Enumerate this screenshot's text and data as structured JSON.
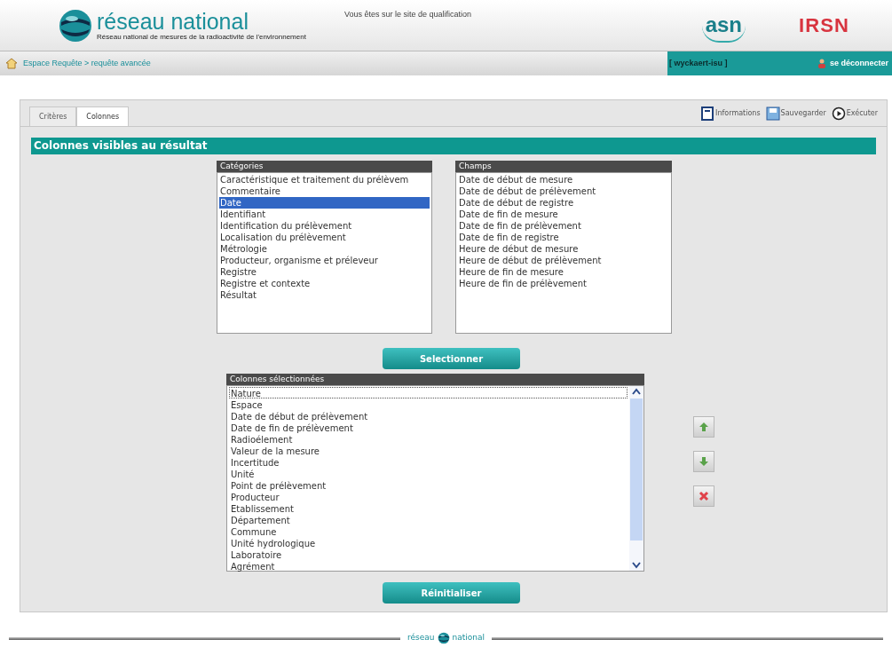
{
  "header": {
    "logo_title": "réseau national",
    "logo_subtitle": "Réseau national de mesures de la radioactivité de l'environnement",
    "notice": "Vous êtes sur le site de qualification",
    "partner_logos": [
      "asn",
      "IRSN"
    ]
  },
  "breadcrumb": {
    "text": "Espace Requête > requête avancée"
  },
  "user": {
    "name": "[ wyckaert-isu ]",
    "logout": "se déconnecter"
  },
  "tabs": [
    {
      "label": "Critères",
      "selected": false
    },
    {
      "label": "Colonnes",
      "selected": true
    }
  ],
  "toolbar": [
    {
      "kind": "info",
      "label": "Informations"
    },
    {
      "kind": "save",
      "label": "Sauvegarder"
    },
    {
      "kind": "run",
      "label": "Exécuter"
    }
  ],
  "section_title": "Colonnes visibles au résultat",
  "categories": {
    "header": "Catégories",
    "items": [
      {
        "label": "Caractéristique et traitement du prélèvem",
        "selected": false
      },
      {
        "label": "Commentaire",
        "selected": false
      },
      {
        "label": "Date",
        "selected": true
      },
      {
        "label": "Identifiant",
        "selected": false
      },
      {
        "label": "Identification du prélèvement",
        "selected": false
      },
      {
        "label": "Localisation du prélèvement",
        "selected": false
      },
      {
        "label": "Métrologie",
        "selected": false
      },
      {
        "label": "Producteur, organisme et préleveur",
        "selected": false
      },
      {
        "label": "Registre",
        "selected": false
      },
      {
        "label": "Registre et contexte",
        "selected": false
      },
      {
        "label": "Résultat",
        "selected": false
      }
    ]
  },
  "fields": {
    "header": "Champs",
    "items": [
      {
        "label": "Date de début de mesure",
        "selected": false
      },
      {
        "label": "Date de début de prélèvement",
        "selected": false
      },
      {
        "label": "Date de début de registre",
        "selected": false
      },
      {
        "label": "Date de fin de mesure",
        "selected": false
      },
      {
        "label": "Date de fin de prélèvement",
        "selected": false
      },
      {
        "label": "Date de fin de registre",
        "selected": false
      },
      {
        "label": "Heure de début de mesure",
        "selected": false
      },
      {
        "label": "Heure de début de prélèvement",
        "selected": false
      },
      {
        "label": "Heure de fin de mesure",
        "selected": false
      },
      {
        "label": "Heure de fin de prélèvement",
        "selected": false
      }
    ]
  },
  "select_button": "Selectionner",
  "selected_columns": {
    "header": "Colonnes sélectionnées",
    "items": [
      {
        "label": "Nature",
        "focused": true
      },
      {
        "label": "Espace",
        "focused": false
      },
      {
        "label": "Date de début de prélèvement",
        "focused": false
      },
      {
        "label": "Date de fin de prélèvement",
        "focused": false
      },
      {
        "label": "Radioélement",
        "focused": false
      },
      {
        "label": "Valeur de la mesure",
        "focused": false
      },
      {
        "label": "Incertitude",
        "focused": false
      },
      {
        "label": "Unité",
        "focused": false
      },
      {
        "label": "Point de prélèvement",
        "focused": false
      },
      {
        "label": "Producteur",
        "focused": false
      },
      {
        "label": "Etablissement",
        "focused": false
      },
      {
        "label": "Département",
        "focused": false
      },
      {
        "label": "Commune",
        "focused": false
      },
      {
        "label": "Unité hydrologique",
        "focused": false
      },
      {
        "label": "Laboratoire",
        "focused": false
      },
      {
        "label": "Agrément",
        "focused": false
      }
    ]
  },
  "order_buttons": [
    {
      "kind": "up"
    },
    {
      "kind": "down"
    },
    {
      "kind": "remove"
    }
  ],
  "reset_button": "Réinitialiser",
  "footer": {
    "left": "réseau",
    "right": "national"
  }
}
